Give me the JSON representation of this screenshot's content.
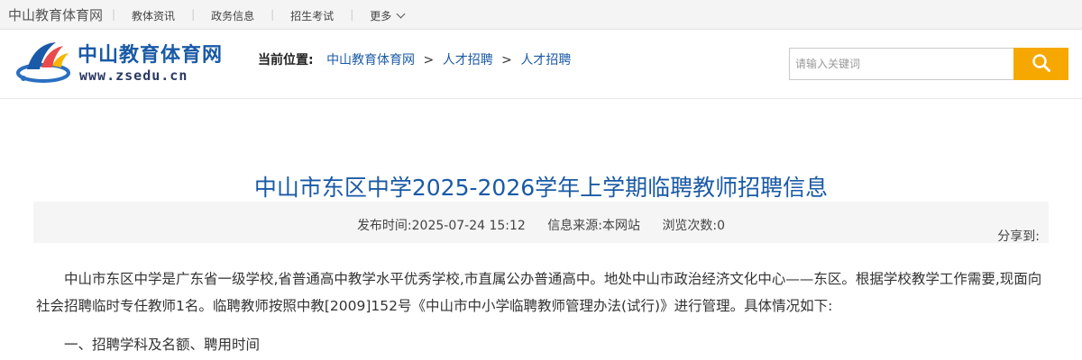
{
  "topbar": {
    "site_name": "中山教育体育网",
    "nav": [
      "教体资讯",
      "政务信息",
      "招生考试"
    ],
    "more_label": "更多"
  },
  "header": {
    "logo_cn": "中山教育体育网",
    "logo_en": "www.zsedu.cn",
    "breadcrumb_label": "当前位置:",
    "breadcrumb": [
      "中山教育体育网",
      "人才招聘",
      "人才招聘"
    ],
    "search_placeholder": "请输入关键词"
  },
  "article": {
    "title": "中山市东区中学2025-2026学年上学期临聘教师招聘信息",
    "meta": {
      "publish_time": "发布时间:2025-07-24 15:12",
      "source": "信息来源:本网站",
      "views": "浏览次数:0"
    },
    "share_label": "分享到:",
    "paragraph1": "中山市东区中学是广东省一级学校,省普通高中教学水平优秀学校,市直属公办普通高中。地处中山市政治经济文化中心——东区。根据学校教学工作需要,现面向社会招聘临时专任教师1名。临聘教师按照中教[2009]152号《中山市中小学临聘教师管理办法(试行)》进行管理。具体情况如下:",
    "section1": "一、招聘学科及名额、聘用时间"
  },
  "colors": {
    "brand_blue": "#1a5aa6",
    "search_button": "#f7a800"
  }
}
